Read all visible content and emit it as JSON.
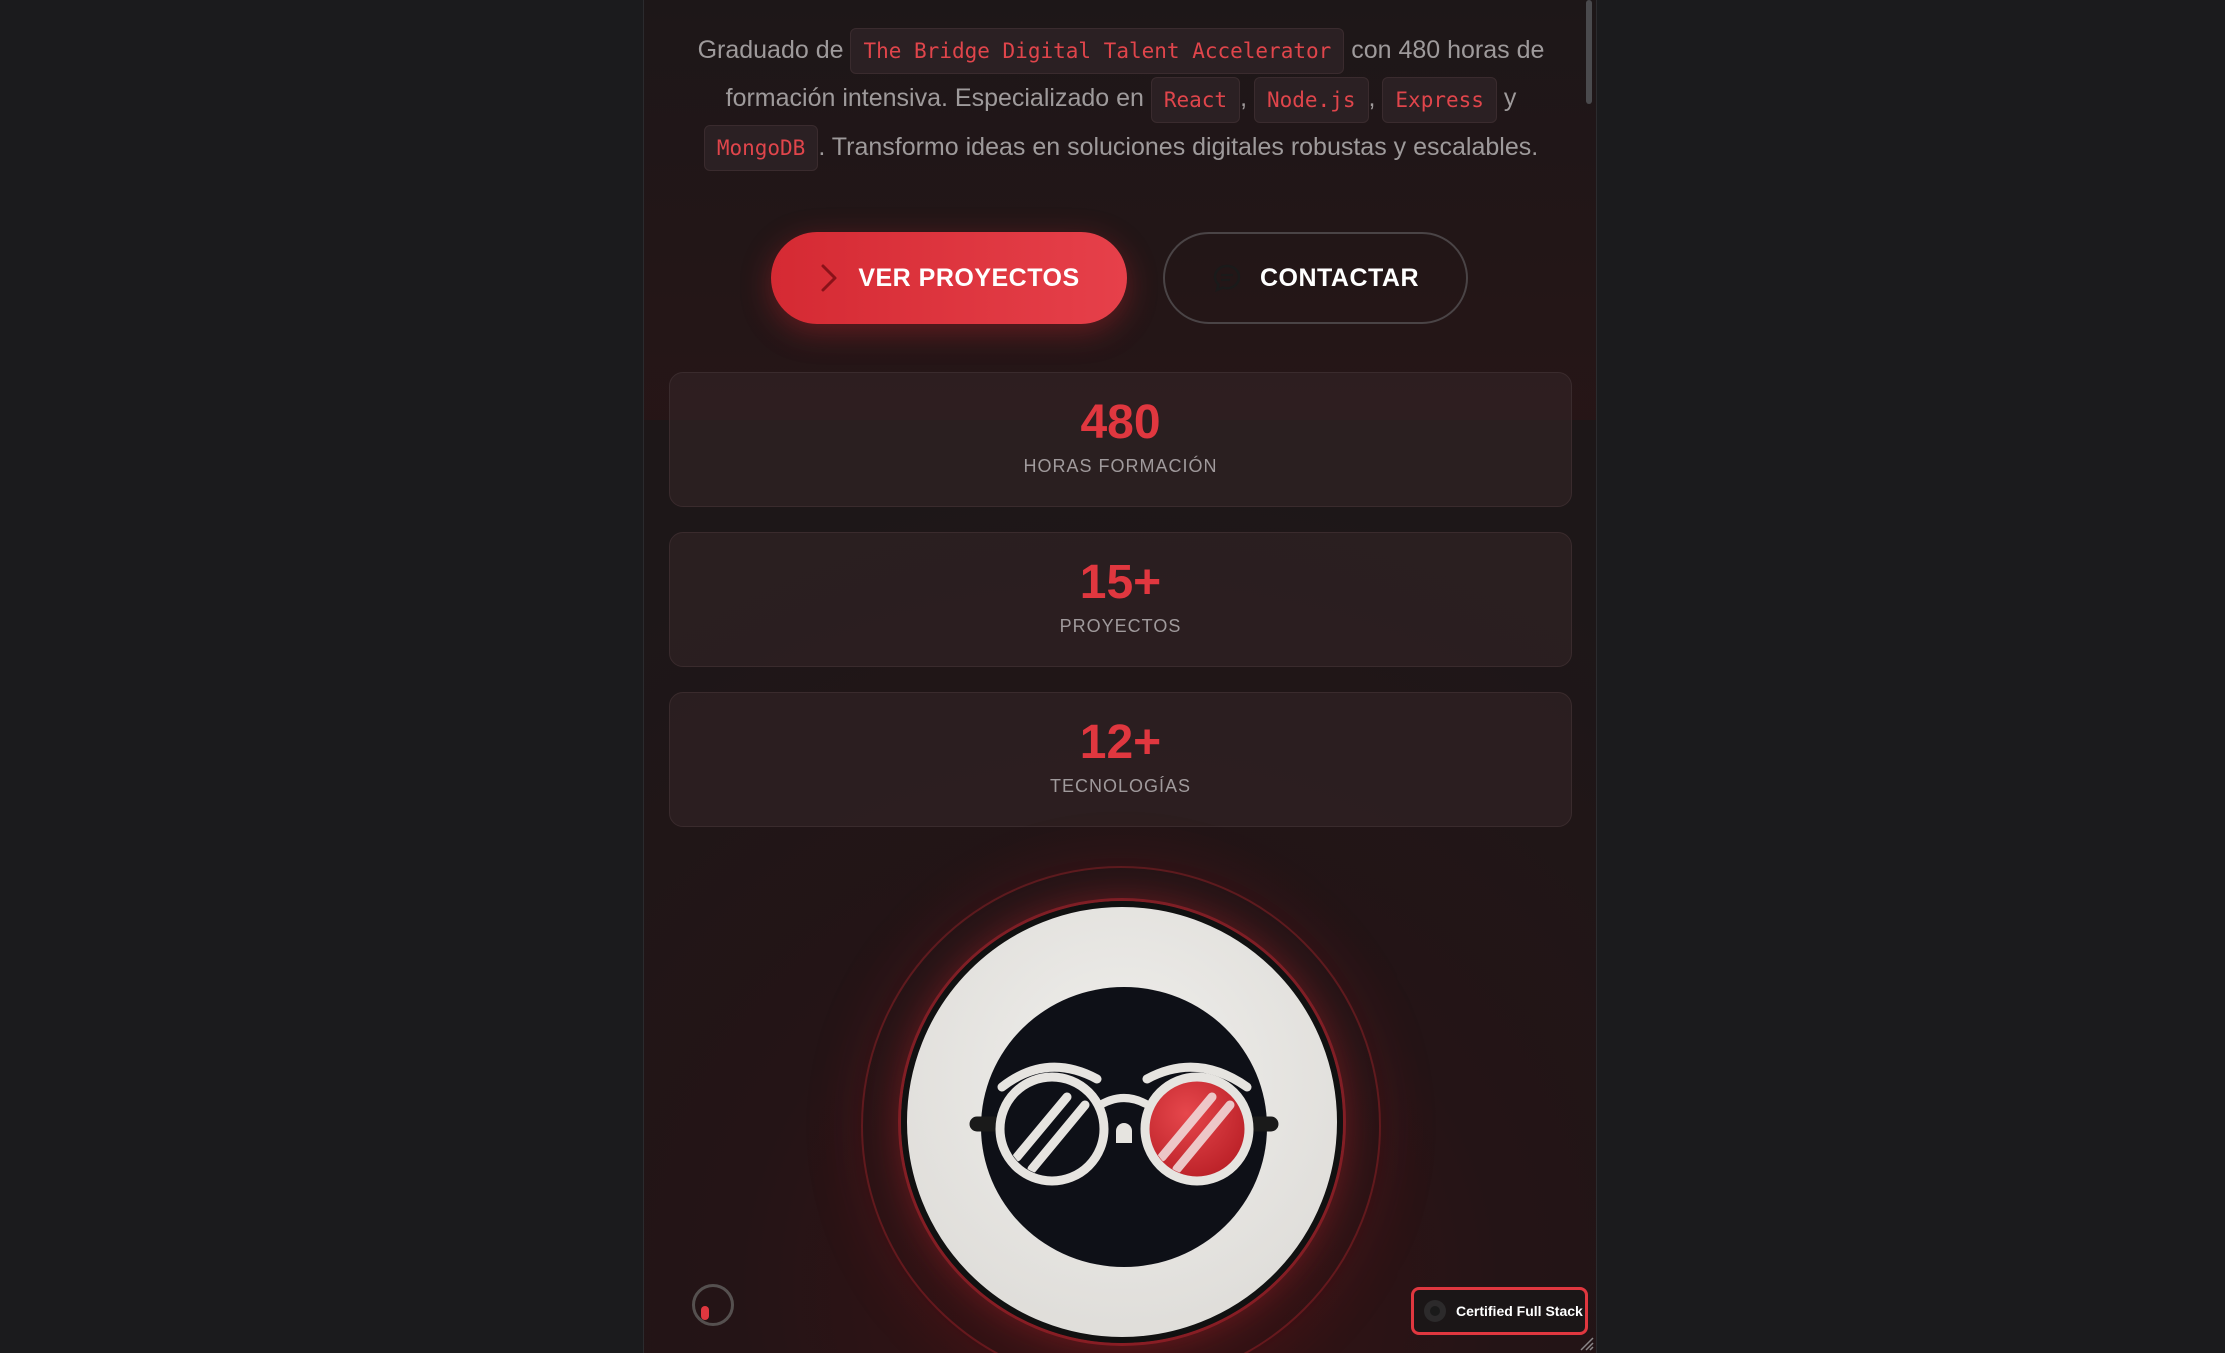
{
  "intro": {
    "text_1": "Graduado de ",
    "chip_bootcamp": "The Bridge Digital Talent Accelerator",
    "text_2": " con 480 horas de formación intensiva. Especializado en ",
    "chip_react": "React",
    "sep_1": ", ",
    "chip_node": "Node.js",
    "sep_2": ", ",
    "chip_express": "Express",
    "text_3": " y ",
    "chip_mongo": "MongoDB",
    "text_4": ". Transformo ideas en soluciones digitales robustas y escalables."
  },
  "buttons": {
    "primary_label": "VER PROYECTOS",
    "primary_icon": "chevron-right-icon",
    "secondary_label": "CONTACTAR",
    "secondary_icon": "chat-icon"
  },
  "stats": [
    {
      "value": "480",
      "label": "HORAS FORMACIÓN"
    },
    {
      "value": "15+",
      "label": "PROYECTOS"
    },
    {
      "value": "12+",
      "label": "TECNOLOGÍAS"
    }
  ],
  "badge": {
    "label": "Certified Full Stack"
  },
  "colors": {
    "accent": "#e0373f",
    "background": "#1b1b1d",
    "text_muted": "#9e9a9b"
  }
}
